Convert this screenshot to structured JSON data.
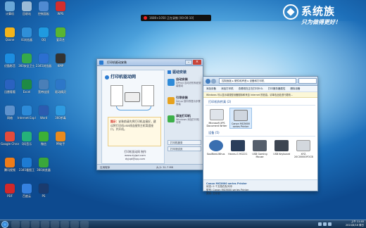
{
  "brand": {
    "name": "系统族",
    "slogan": "只为做得更好！"
  },
  "recorder": {
    "text": "1680×1050  正在录制  [00:00:10]"
  },
  "desktop_icons": [
    {
      "label": "计算机",
      "color": "#6aa7d8"
    },
    {
      "label": "Qzone",
      "color": "#f3b41b"
    },
    {
      "label": "优酷影音",
      "color": "#1c8de0"
    },
    {
      "label": "迅雷看看",
      "color": "#2a62c0"
    },
    {
      "label": "网络",
      "color": "#5d91cc"
    },
    {
      "label": "Google Chrome",
      "color": "#e44b3c"
    },
    {
      "label": "腾讯视频",
      "color": "#ef7c18"
    },
    {
      "label": "PDF",
      "color": "#d1282a"
    },
    {
      "label": "回收站",
      "color": "#9bbbd7"
    },
    {
      "label": "IE浏览器",
      "color": "#2f8fd8"
    },
    {
      "label": "360安全卫士",
      "color": "#35a94b"
    },
    {
      "label": "Excel",
      "color": "#1e8a45"
    },
    {
      "label": "Internet Explorer",
      "color": "#2c8ad8"
    },
    {
      "label": "QQ音乐",
      "color": "#25b27a"
    },
    {
      "label": "2345看图王",
      "color": "#1d7bd3"
    },
    {
      "label": "百度云",
      "color": "#3581e0"
    },
    {
      "label": "控制面板",
      "color": "#4f8ad1"
    },
    {
      "label": "QQ",
      "color": "#1f9ae0"
    },
    {
      "label": "2345浏览器",
      "color": "#2b6fd0"
    },
    {
      "label": "宽带连接",
      "color": "#4a7fb8"
    },
    {
      "label": "Word",
      "color": "#2b5cb0"
    },
    {
      "label": "微信",
      "color": "#3cb035"
    },
    {
      "label": "360浏览器",
      "color": "#3aa63a"
    },
    {
      "label": "PS",
      "color": "#1a3b6e"
    },
    {
      "label": "WPS",
      "color": "#d22e2e"
    },
    {
      "label": "爱奇艺",
      "color": "#58b531"
    },
    {
      "label": "KMP",
      "color": "#333333"
    },
    {
      "label": "驱动精灵",
      "color": "#2d77c8"
    },
    {
      "label": "360杀毒",
      "color": "#2e9ae0"
    },
    {
      "label": "PP助手",
      "color": "#e88a1e"
    }
  ],
  "driver_window": {
    "title": "打印机驱动安装",
    "panel_title": "打印机驱动网",
    "note_red": "提示：",
    "note_text": "安装前请先将打印机连接好，建议将打印机USB线连接到主机背面接口，并开机。",
    "site1": "打印机驱动网 制作",
    "site2": "www.dyjqd.com",
    "site3": "dyjqd@qq.com",
    "section": "驱动安装",
    "options": [
      {
        "title": "自动安装",
        "desc": "DPInst 自动识别系统安装驱动"
      },
      {
        "title": "引导安装",
        "desc": "Setup 按向导提示步骤安装"
      },
      {
        "title": "添加打印机",
        "desc": "Windows 添加打印机向导"
      }
    ],
    "buttons": [
      "打印机服务",
      "打印测试页"
    ],
    "status_left": "应用程序",
    "status_right": "大小: 31.7 MB"
  },
  "devices_window": {
    "address": "控制面板 ▸ 硬件和声音 ▸ 设备和打印机",
    "tools": [
      "添加设备",
      "添加打印机",
      "查看现在正在打印什么",
      "打印服务器属性",
      "删除设备"
    ],
    "info": "Windows 可以显示增强型设备图标和来自 Internet 的信息。请单击此处进行更改...",
    "printers_title": "打印机和传真 (2)",
    "printers": [
      {
        "label": "Microsoft XPS Document Writer",
        "color": "#dfe4ea"
      },
      {
        "label": "Canon MG3600 series Printer",
        "color": "#cfd6df"
      }
    ],
    "devices_title": "设备 (5)",
    "devices": [
      {
        "label": "SoulBeat-Whus",
        "color": "#3a6fb0"
      },
      {
        "label": "Hanns-G HG221",
        "color": "#2b3e5a"
      },
      {
        "label": "USB Gaming Mouse",
        "color": "#555e6b"
      },
      {
        "label": "USB Keyboard",
        "color": "#3d4551"
      },
      {
        "label": "XYZ-20C00000FOCB",
        "color": "#d3d8de"
      }
    ],
    "status_name": "Canon MG3600 series Printer",
    "status_state": "状态: 0 个文档在队列中",
    "status_model": "型号: Canon MG3600 series Printer",
    "status_cat": "类别: 打印机"
  },
  "taskbar": {
    "time": "上午 11:40",
    "date": "2024/8/18 周日"
  }
}
